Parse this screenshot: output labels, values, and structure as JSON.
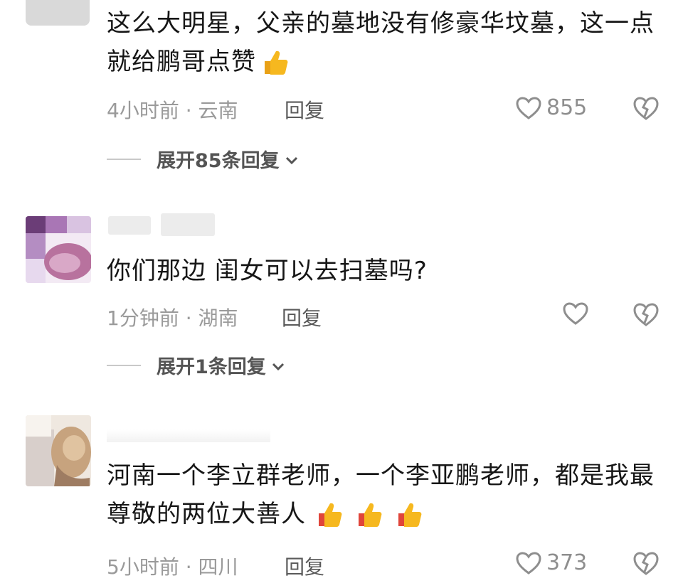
{
  "comments": [
    {
      "text": "这么大明星，父亲的墓地没有修豪华坟墓，这一点就给鹏哥点赞",
      "time": "4小时前",
      "location": "云南",
      "reply_label": "回复",
      "likes": "855",
      "expand_label": "展开85条回复"
    },
    {
      "text": "你们那边 闺女可以去扫墓吗?",
      "time": "1分钟前",
      "location": "湖南",
      "reply_label": "回复",
      "likes": "",
      "expand_label": "展开1条回复"
    },
    {
      "text": "河南一个李立群老师，一个李亚鹏老师，都是我最尊敬的两位大善人",
      "time": "5小时前",
      "location": "四川",
      "reply_label": "回复",
      "likes": "373"
    }
  ],
  "icons": [
    "thumbs-up-emoji",
    "heart-icon",
    "broken-heart-icon",
    "chevron-down-icon"
  ],
  "colors": {
    "text": "#161616",
    "meta": "#9a9a9a",
    "icon": "#8e8e8e",
    "emoji": "#f6b81f"
  }
}
